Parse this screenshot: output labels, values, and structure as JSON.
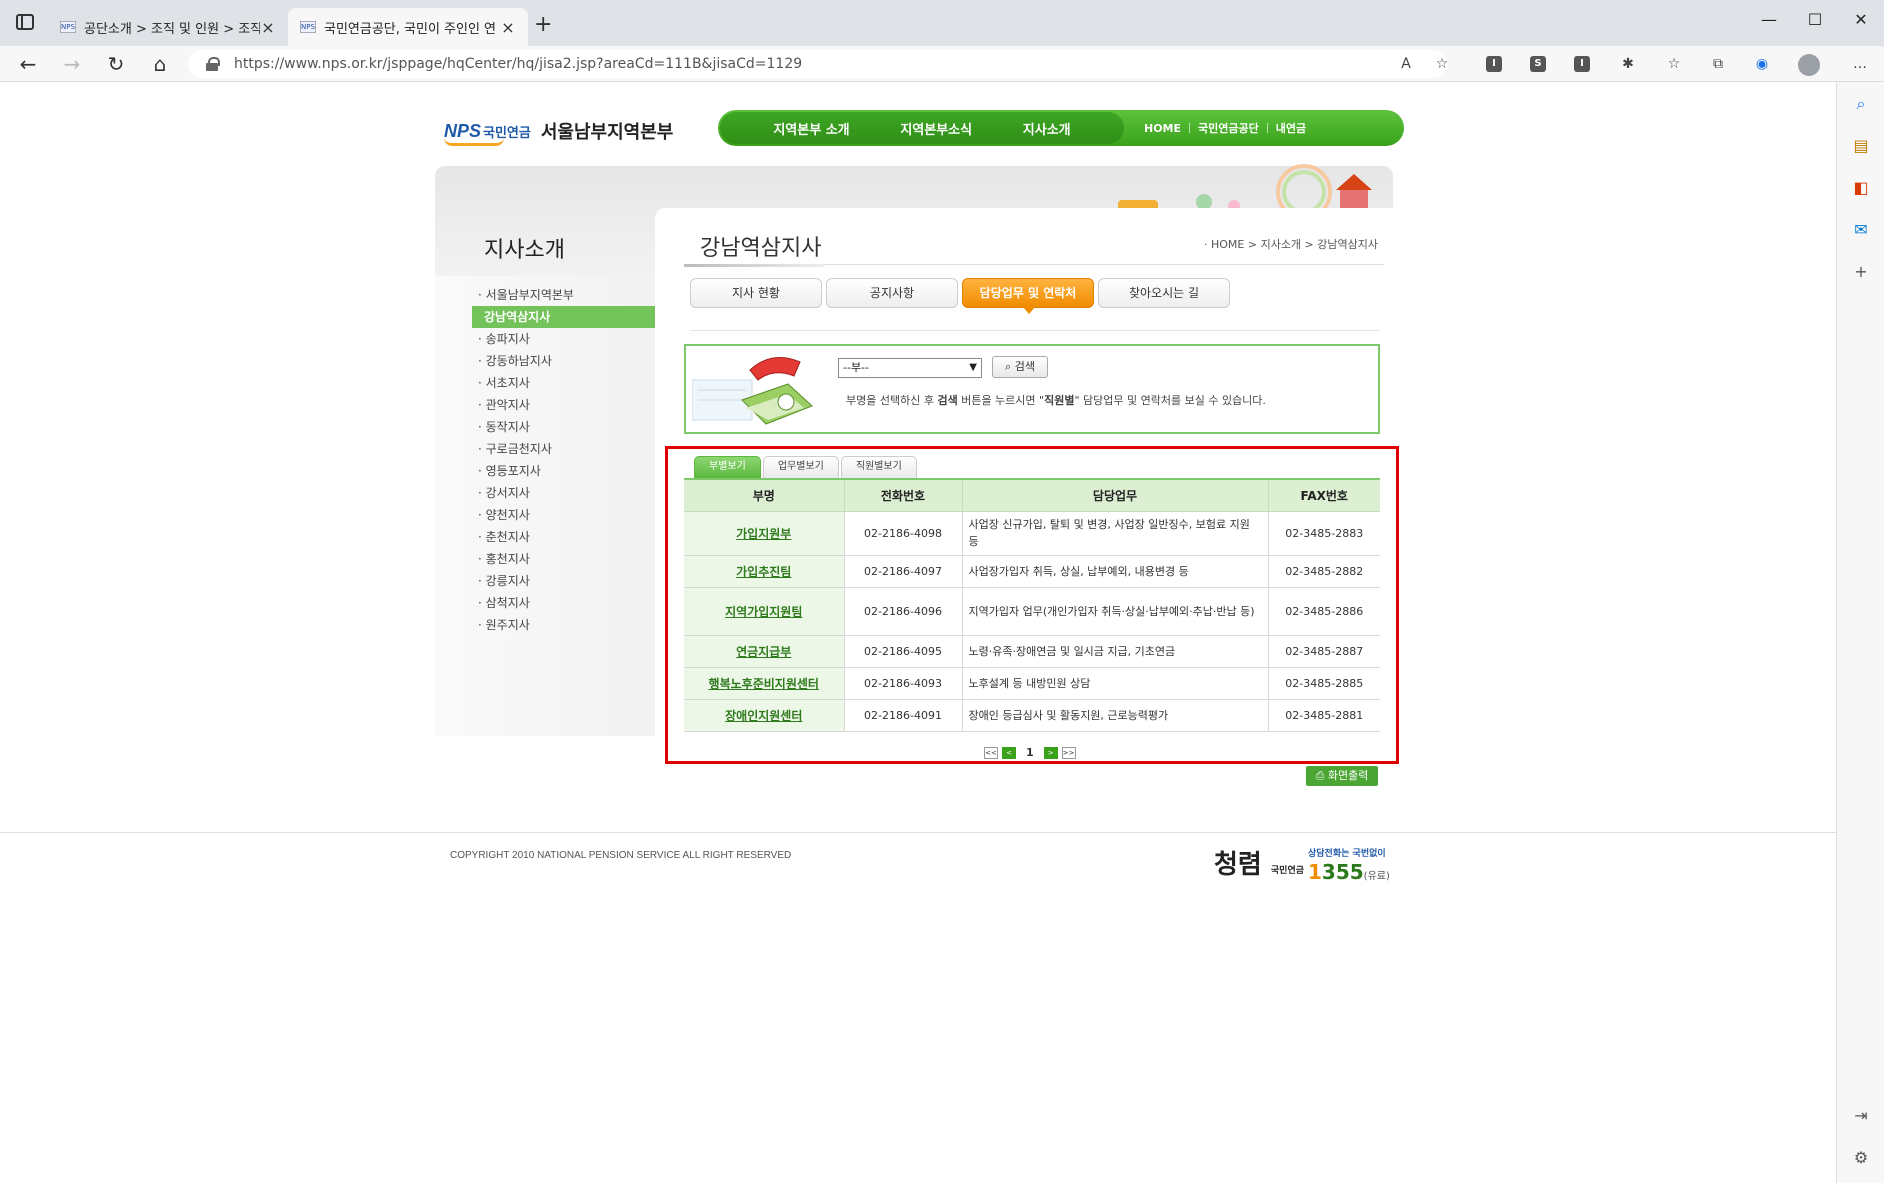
{
  "browser": {
    "tabs": [
      {
        "favicon": "NPS",
        "title": "공단소개 > 조직 및 인원 > 조직"
      },
      {
        "favicon": "NPS",
        "title": "국민연금공단, 국민이 주인인 연"
      }
    ],
    "url": "https://www.nps.or.kr/jsppage/hqCenter/hq/jisa2.jsp?areaCd=111B&jisaCd=1129"
  },
  "site": {
    "logo_en": "NPS",
    "logo_kr": "국민연금",
    "region": "서울남부지역본부",
    "gnb": [
      "지역본부 소개",
      "지역본부소식",
      "지사소개"
    ],
    "util": [
      "HOME",
      "국민연금공단",
      "내연금"
    ]
  },
  "lnb": {
    "title": "지사소개",
    "items": [
      {
        "label": "· 서울남부지역본부"
      },
      {
        "label": "강남역삼지사"
      },
      {
        "label": "· 송파지사"
      },
      {
        "label": "· 강동하남지사"
      },
      {
        "label": "· 서초지사"
      },
      {
        "label": "· 관악지사"
      },
      {
        "label": "· 동작지사"
      },
      {
        "label": "· 구로금천지사"
      },
      {
        "label": "· 영등포지사"
      },
      {
        "label": "· 강서지사"
      },
      {
        "label": "· 양천지사"
      },
      {
        "label": "· 춘천지사"
      },
      {
        "label": "· 홍천지사"
      },
      {
        "label": "· 강릉지사"
      },
      {
        "label": "· 삼척지사"
      },
      {
        "label": "· 원주지사"
      }
    ]
  },
  "content": {
    "title": "강남역삼지사",
    "breadcrumb": "· HOME > 지사소개 > 강남역삼지사",
    "subtabs": [
      "지사 현황",
      "공지사항",
      "담당업무 및 연락처",
      "찾아오시는 길"
    ],
    "search": {
      "select_value": "--부--",
      "button": "검색",
      "desc_pre": "부명을 선택하신 후 ",
      "desc_b1": "검색",
      "desc_mid": " 버튼을 누르시면 \"",
      "desc_b2": "직원별",
      "desc_post": "\" 담당업무 및 연락처를 보실 수 있습니다."
    },
    "viewtabs": [
      "부별보기",
      "업무별보기",
      "직원별보기"
    ],
    "table": {
      "headers": [
        "부명",
        "전화번호",
        "담당업무",
        "FAX번호"
      ],
      "rows": [
        {
          "dept": "가입지원부",
          "phone": "02-2186-4098",
          "duty": "사업장 신규가입, 탈퇴 및 변경, 사업장 일반징수, 보험료 지원 등",
          "fax": "02-3485-2883"
        },
        {
          "dept": "가입추진팀",
          "phone": "02-2186-4097",
          "duty": "사업장가입자 취득, 상실, 납부예외, 내용변경 등",
          "fax": "02-3485-2882"
        },
        {
          "dept": "지역가입지원팀",
          "phone": "02-2186-4096",
          "duty": "지역가입자 업무(개인가입자 취득·상실·납부예외·추납·반납 등)",
          "fax": "02-3485-2886"
        },
        {
          "dept": "연금지급부",
          "phone": "02-2186-4095",
          "duty": "노령·유족·장애연금 및 일시금 지급, 기초연금",
          "fax": "02-3485-2887"
        },
        {
          "dept": "행복노후준비지원센터",
          "phone": "02-2186-4093",
          "duty": "노후설계 등 내방민원 상담",
          "fax": "02-3485-2885"
        },
        {
          "dept": "장애인지원센터",
          "phone": "02-2186-4091",
          "duty": "장애인 등급심사 및 활동지원, 근로능력평가",
          "fax": "02-3485-2881"
        }
      ]
    },
    "pager": {
      "current": "1",
      "first": "<<",
      "prev": "<",
      "next": ">",
      "last": ">>"
    },
    "print_button": "화면출력"
  },
  "footer": {
    "copyright": "COPYRIGHT 2010 NATIONAL PENSION SERVICE ALL RIGHT RESERVED",
    "brand": "청렴",
    "brand_sub": "국민연금",
    "call_text": "상담전화는 국번없이",
    "call_number_a": "1",
    "call_number_b": "355",
    "call_suffix": "(유료)"
  }
}
